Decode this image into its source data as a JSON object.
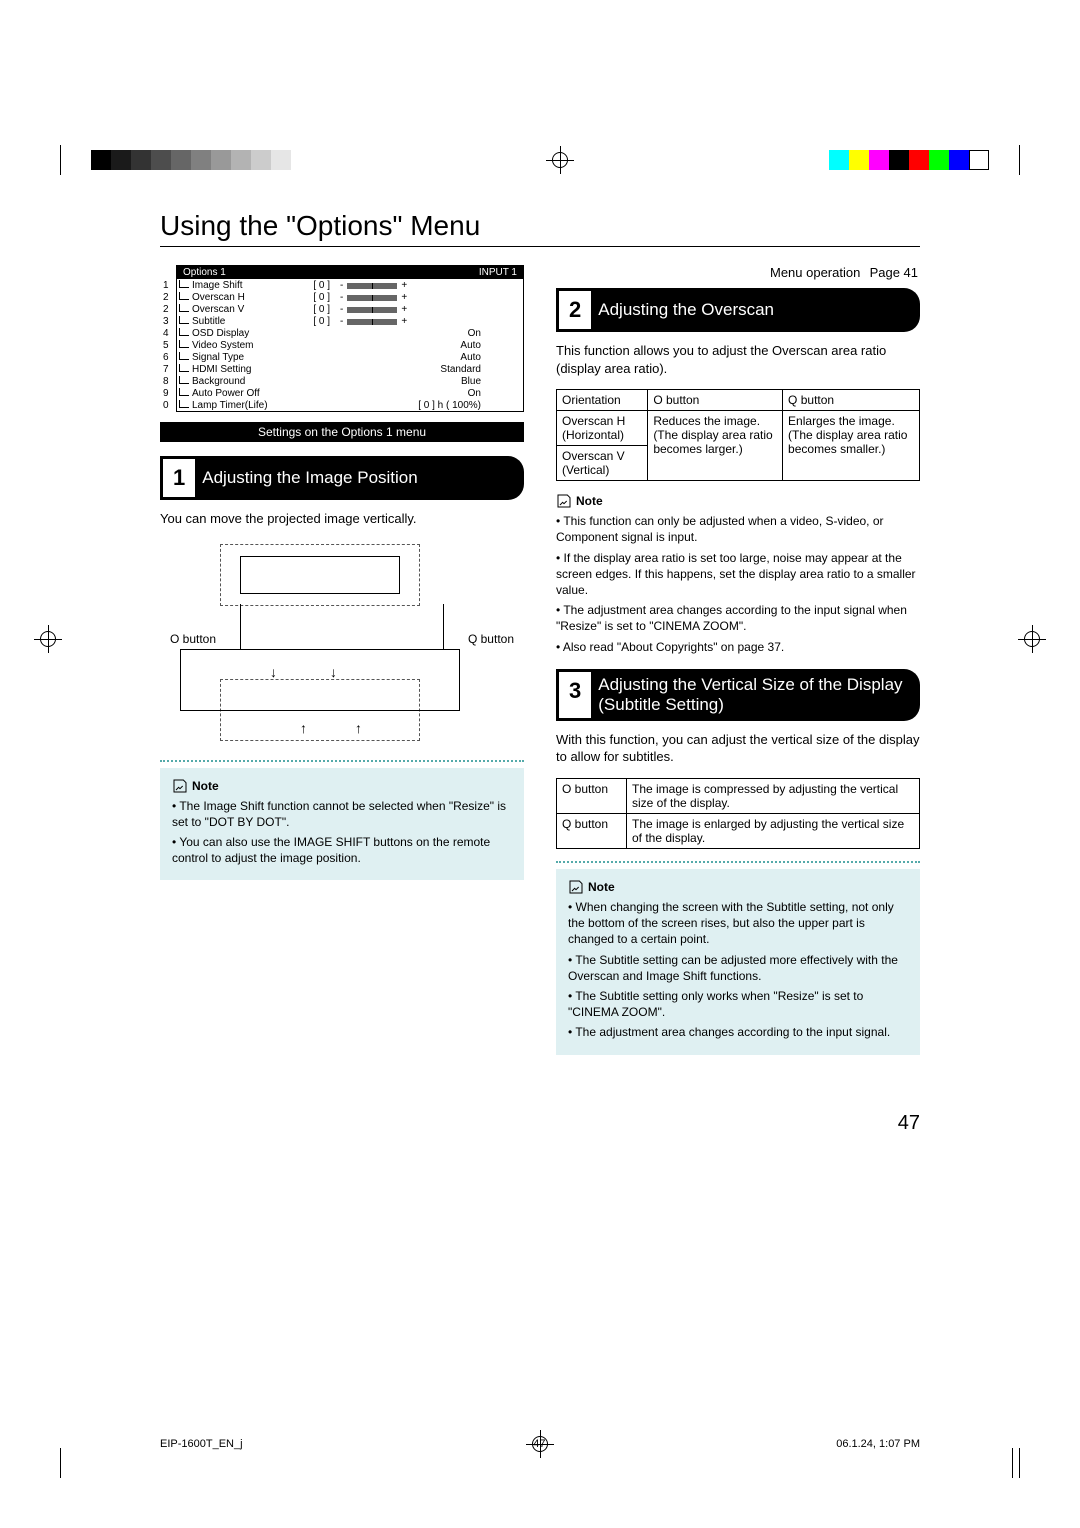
{
  "page_title": "Using the \"Options\" Menu",
  "menu_operation": {
    "label": "Menu operation",
    "page_label": "Page 41"
  },
  "osd": {
    "header_left": "Options 1",
    "header_right": "INPUT 1",
    "rows": [
      {
        "num": "1",
        "label": "Image Shift",
        "bracket": "[   0 ]",
        "minus": "-",
        "plus": "+"
      },
      {
        "num": "2",
        "label": "Overscan H",
        "bracket": "[   0 ]",
        "minus": "-",
        "plus": "+"
      },
      {
        "num": "2",
        "label": "Overscan V",
        "bracket": "[   0 ]",
        "minus": "-",
        "plus": "+"
      },
      {
        "num": "3",
        "label": "Subtitle",
        "bracket": "[   0 ]",
        "minus": "-",
        "plus": "+"
      },
      {
        "num": "4",
        "label": "OSD Display",
        "value": "On"
      },
      {
        "num": "5",
        "label": "Video System",
        "value": "Auto"
      },
      {
        "num": "6",
        "label": "Signal Type",
        "value": "Auto"
      },
      {
        "num": "7",
        "label": "HDMI Setting",
        "value": "Standard"
      },
      {
        "num": "8",
        "label": "Background",
        "value": "Blue"
      },
      {
        "num": "9",
        "label": "Auto Power Off",
        "value": "On"
      },
      {
        "num": "0",
        "label": "Lamp Timer(Life)",
        "value": "[   0 ] h   ( 100%)"
      }
    ]
  },
  "gray_bar": "Settings on the Options 1 menu",
  "section1": {
    "num": "1",
    "title": "Adjusting the Image Position",
    "body": "You can move the projected image vertically.",
    "btn_left": "O button",
    "btn_right": "Q button",
    "note_title": "Note",
    "notes": [
      "The Image Shift function cannot be selected when \"Resize\" is set to \"DOT BY DOT\".",
      "You can also use the IMAGE SHIFT buttons on the remote control to adjust the image position."
    ]
  },
  "section2": {
    "num": "2",
    "title": "Adjusting the Overscan",
    "body": "This function allows you to adjust the Overscan area ratio (display area ratio).",
    "table": {
      "head": [
        "Orientation",
        "O button",
        "Q button"
      ],
      "rows": [
        [
          "Overscan H (Horizontal)",
          "Reduces the image. (The display area ratio becomes larger.)",
          "Enlarges the image. (The display area ratio becomes smaller.)"
        ],
        [
          "Overscan V (Vertical)",
          "",
          ""
        ]
      ]
    },
    "note_title": "Note",
    "notes": [
      "This function can only be adjusted when a video, S-video, or Component signal is input.",
      "If the display area ratio is set too large, noise may appear at the screen edges. If this happens, set the display area ratio to a smaller value.",
      "The adjustment area changes according to the input signal when \"Resize\" is set to \"CINEMA ZOOM\".",
      "Also read \"About Copyrights\" on page 37."
    ]
  },
  "section3": {
    "num": "3",
    "title": "Adjusting the Vertical Size of the Display (Subtitle Setting)",
    "body": "With this function, you can adjust the vertical size of the display to allow for subtitles.",
    "table": {
      "rows": [
        [
          "O button",
          "The image is compressed by adjusting the vertical size of the display."
        ],
        [
          "Q button",
          "The image is enlarged by adjusting the vertical size of the display."
        ]
      ]
    },
    "note_title": "Note",
    "notes": [
      "When changing the screen with the Subtitle setting, not only the bottom of the screen rises, but also the upper part is changed to a certain point.",
      "The Subtitle setting can be adjusted more effectively with the Overscan and Image Shift functions.",
      "The Subtitle setting only works when \"Resize\" is set to \"CINEMA ZOOM\".",
      "The adjustment area changes according to the input signal."
    ]
  },
  "page_number": "47",
  "footer": {
    "left": "EIP-1600T_EN_j",
    "center": "47",
    "right": "06.1.24, 1:07 PM"
  }
}
